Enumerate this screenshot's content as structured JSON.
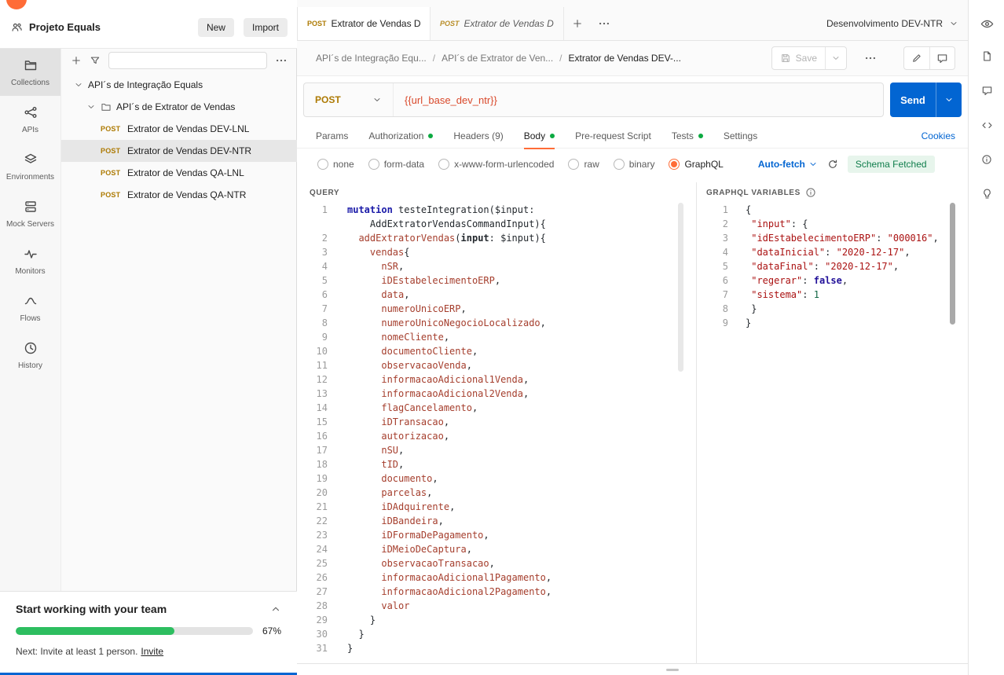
{
  "colors": {
    "brand_orange": "#ff6c37",
    "method_post": "#ad7a03",
    "send_blue": "#0265d2",
    "success_green": "#0caa41",
    "progress_green": "#2dbe60",
    "variable_red": "#d9492b"
  },
  "topbar": {
    "workspace": "Projeto Equals",
    "new_button": "New",
    "import_button": "Import"
  },
  "tabstrip": {
    "tabs": [
      {
        "method": "POST",
        "label": "Extrator de Vendas DEV",
        "active": true
      },
      {
        "method": "POST",
        "label": "Extrator de Vendas DEV",
        "active": false
      }
    ],
    "environment": "Desenvolvimento DEV-NTR"
  },
  "rail": [
    {
      "label": "Collections",
      "icon": "collections-icon",
      "active": true
    },
    {
      "label": "APIs",
      "icon": "apis-icon",
      "active": false
    },
    {
      "label": "Environments",
      "icon": "environments-icon",
      "active": false
    },
    {
      "label": "Mock Servers",
      "icon": "mock-servers-icon",
      "active": false
    },
    {
      "label": "Monitors",
      "icon": "monitors-icon",
      "active": false
    },
    {
      "label": "Flows",
      "icon": "flows-icon",
      "active": false
    },
    {
      "label": "History",
      "icon": "history-icon",
      "active": false
    }
  ],
  "tree": {
    "root_label": "API´s de Integração Equals",
    "folder_label": "API´s de Extrator de Vendas",
    "requests": [
      {
        "method": "POST",
        "label": "Extrator de Vendas DEV-LNL",
        "selected": false
      },
      {
        "method": "POST",
        "label": "Extrator de Vendas DEV-NTR",
        "selected": true
      },
      {
        "method": "POST",
        "label": "Extrator de Vendas QA-LNL",
        "selected": false
      },
      {
        "method": "POST",
        "label": "Extrator de Vendas QA-NTR",
        "selected": false
      }
    ]
  },
  "breadcrumb": {
    "items": [
      "API´s de Integração Equ...",
      "API´s de Extrator de Ven...",
      "Extrator de Vendas DEV-..."
    ],
    "save_label": "Save"
  },
  "request": {
    "method": "POST",
    "url": "{{url_base_dev_ntr}}",
    "send_label": "Send"
  },
  "request_tabs": [
    {
      "label": "Params",
      "dot": false,
      "active": false
    },
    {
      "label": "Authorization",
      "dot": true,
      "active": false
    },
    {
      "label": "Headers (9)",
      "dot": false,
      "active": false
    },
    {
      "label": "Body",
      "dot": true,
      "active": true
    },
    {
      "label": "Pre-request Script",
      "dot": false,
      "active": false
    },
    {
      "label": "Tests",
      "dot": true,
      "active": false
    },
    {
      "label": "Settings",
      "dot": false,
      "active": false
    }
  ],
  "cookies_label": "Cookies",
  "body_modes": [
    {
      "label": "none",
      "selected": false
    },
    {
      "label": "form-data",
      "selected": false
    },
    {
      "label": "x-www-form-urlencoded",
      "selected": false
    },
    {
      "label": "raw",
      "selected": false
    },
    {
      "label": "binary",
      "selected": false
    },
    {
      "label": "GraphQL",
      "selected": true
    }
  ],
  "graphql": {
    "autofetch_label": "Auto-fetch",
    "schema_status": "Schema Fetched",
    "query_title": "QUERY",
    "variables_title": "GRAPHQL VARIABLES",
    "query_lines": [
      {
        "n": "1",
        "t": [
          [
            "k",
            "mutation"
          ],
          [
            "p",
            " testeIntegration("
          ],
          [
            "v",
            "$input"
          ],
          [
            "p",
            ":"
          ]
        ]
      },
      {
        "n": "",
        "t": [
          [
            "p",
            "    AddExtratorVendasCommandInput){"
          ]
        ]
      },
      {
        "n": "2",
        "t": [
          [
            "p",
            "  "
          ],
          [
            "f",
            "addExtratorVendas"
          ],
          [
            "p",
            "("
          ],
          [
            "a",
            "input"
          ],
          [
            "p",
            ": "
          ],
          [
            "v",
            "$input"
          ],
          [
            "p",
            "){"
          ]
        ]
      },
      {
        "n": "3",
        "t": [
          [
            "p",
            "    "
          ],
          [
            "f",
            "vendas"
          ],
          [
            "p",
            "{"
          ]
        ]
      },
      {
        "n": "4",
        "t": [
          [
            "p",
            "      "
          ],
          [
            "f",
            "nSR"
          ],
          [
            "p",
            ","
          ]
        ]
      },
      {
        "n": "5",
        "t": [
          [
            "p",
            "      "
          ],
          [
            "f",
            "iDEstabelecimentoERP"
          ],
          [
            "p",
            ","
          ]
        ]
      },
      {
        "n": "6",
        "t": [
          [
            "p",
            "      "
          ],
          [
            "f",
            "data"
          ],
          [
            "p",
            ","
          ]
        ]
      },
      {
        "n": "7",
        "t": [
          [
            "p",
            "      "
          ],
          [
            "f",
            "numeroUnicoERP"
          ],
          [
            "p",
            ","
          ]
        ]
      },
      {
        "n": "8",
        "t": [
          [
            "p",
            "      "
          ],
          [
            "f",
            "numeroUnicoNegocioLocalizado"
          ],
          [
            "p",
            ","
          ]
        ]
      },
      {
        "n": "9",
        "t": [
          [
            "p",
            "      "
          ],
          [
            "f",
            "nomeCliente"
          ],
          [
            "p",
            ","
          ]
        ]
      },
      {
        "n": "10",
        "t": [
          [
            "p",
            "      "
          ],
          [
            "f",
            "documentoCliente"
          ],
          [
            "p",
            ","
          ]
        ]
      },
      {
        "n": "11",
        "t": [
          [
            "p",
            "      "
          ],
          [
            "f",
            "observacaoVenda"
          ],
          [
            "p",
            ","
          ]
        ]
      },
      {
        "n": "12",
        "t": [
          [
            "p",
            "      "
          ],
          [
            "f",
            "informacaoAdicional1Venda"
          ],
          [
            "p",
            ","
          ]
        ]
      },
      {
        "n": "13",
        "t": [
          [
            "p",
            "      "
          ],
          [
            "f",
            "informacaoAdicional2Venda"
          ],
          [
            "p",
            ","
          ]
        ]
      },
      {
        "n": "14",
        "t": [
          [
            "p",
            "      "
          ],
          [
            "f",
            "flagCancelamento"
          ],
          [
            "p",
            ","
          ]
        ]
      },
      {
        "n": "15",
        "t": [
          [
            "p",
            "      "
          ],
          [
            "f",
            "iDTransacao"
          ],
          [
            "p",
            ","
          ]
        ]
      },
      {
        "n": "16",
        "t": [
          [
            "p",
            "      "
          ],
          [
            "f",
            "autorizacao"
          ],
          [
            "p",
            ","
          ]
        ]
      },
      {
        "n": "17",
        "t": [
          [
            "p",
            "      "
          ],
          [
            "f",
            "nSU"
          ],
          [
            "p",
            ","
          ]
        ]
      },
      {
        "n": "18",
        "t": [
          [
            "p",
            "      "
          ],
          [
            "f",
            "tID"
          ],
          [
            "p",
            ","
          ]
        ]
      },
      {
        "n": "19",
        "t": [
          [
            "p",
            "      "
          ],
          [
            "f",
            "documento"
          ],
          [
            "p",
            ","
          ]
        ]
      },
      {
        "n": "20",
        "t": [
          [
            "p",
            "      "
          ],
          [
            "f",
            "parcelas"
          ],
          [
            "p",
            ","
          ]
        ]
      },
      {
        "n": "21",
        "t": [
          [
            "p",
            "      "
          ],
          [
            "f",
            "iDAdquirente"
          ],
          [
            "p",
            ","
          ]
        ]
      },
      {
        "n": "22",
        "t": [
          [
            "p",
            "      "
          ],
          [
            "f",
            "iDBandeira"
          ],
          [
            "p",
            ","
          ]
        ]
      },
      {
        "n": "23",
        "t": [
          [
            "p",
            "      "
          ],
          [
            "f",
            "iDFormaDePagamento"
          ],
          [
            "p",
            ","
          ]
        ]
      },
      {
        "n": "24",
        "t": [
          [
            "p",
            "      "
          ],
          [
            "f",
            "iDMeioDeCaptura"
          ],
          [
            "p",
            ","
          ]
        ]
      },
      {
        "n": "25",
        "t": [
          [
            "p",
            "      "
          ],
          [
            "f",
            "observacaoTransacao"
          ],
          [
            "p",
            ","
          ]
        ]
      },
      {
        "n": "26",
        "t": [
          [
            "p",
            "      "
          ],
          [
            "f",
            "informacaoAdicional1Pagamento"
          ],
          [
            "p",
            ","
          ]
        ]
      },
      {
        "n": "27",
        "t": [
          [
            "p",
            "      "
          ],
          [
            "f",
            "informacaoAdicional2Pagamento"
          ],
          [
            "p",
            ","
          ]
        ]
      },
      {
        "n": "28",
        "t": [
          [
            "p",
            "      "
          ],
          [
            "f",
            "valor"
          ]
        ]
      },
      {
        "n": "29",
        "t": [
          [
            "p",
            "    }"
          ]
        ]
      },
      {
        "n": "30",
        "t": [
          [
            "p",
            "  }"
          ]
        ]
      },
      {
        "n": "31",
        "t": [
          [
            "p",
            "}"
          ]
        ]
      }
    ],
    "variable_lines": [
      {
        "n": "1",
        "t": [
          [
            "p",
            "{"
          ]
        ]
      },
      {
        "n": "2",
        "t": [
          [
            "p",
            " "
          ],
          [
            "s",
            "\"input\""
          ],
          [
            "p",
            ": {"
          ]
        ]
      },
      {
        "n": "3",
        "t": [
          [
            "p",
            " "
          ],
          [
            "s",
            "\"idEstabelecimentoERP\""
          ],
          [
            "p",
            ": "
          ],
          [
            "s",
            "\"000016\""
          ],
          [
            "p",
            ","
          ]
        ]
      },
      {
        "n": "4",
        "t": [
          [
            "p",
            " "
          ],
          [
            "s",
            "\"dataInicial\""
          ],
          [
            "p",
            ": "
          ],
          [
            "s",
            "\"2020-12-17\""
          ],
          [
            "p",
            ","
          ]
        ]
      },
      {
        "n": "5",
        "t": [
          [
            "p",
            " "
          ],
          [
            "s",
            "\"dataFinal\""
          ],
          [
            "p",
            ": "
          ],
          [
            "s",
            "\"2020-12-17\""
          ],
          [
            "p",
            ","
          ]
        ]
      },
      {
        "n": "6",
        "t": [
          [
            "p",
            " "
          ],
          [
            "s",
            "\"regerar\""
          ],
          [
            "p",
            ": "
          ],
          [
            "b",
            "false"
          ],
          [
            "p",
            ","
          ]
        ]
      },
      {
        "n": "7",
        "t": [
          [
            "p",
            " "
          ],
          [
            "s",
            "\"sistema\""
          ],
          [
            "p",
            ": "
          ],
          [
            "n",
            "1"
          ]
        ]
      },
      {
        "n": "8",
        "t": [
          [
            "p",
            " }"
          ]
        ]
      },
      {
        "n": "9",
        "t": [
          [
            "p",
            "}"
          ]
        ]
      }
    ]
  },
  "team_card": {
    "title": "Start working with your team",
    "progress_percent": 67,
    "progress_label": "67%",
    "next_text": "Next: Invite at least 1 person.",
    "invite_label": "Invite"
  }
}
